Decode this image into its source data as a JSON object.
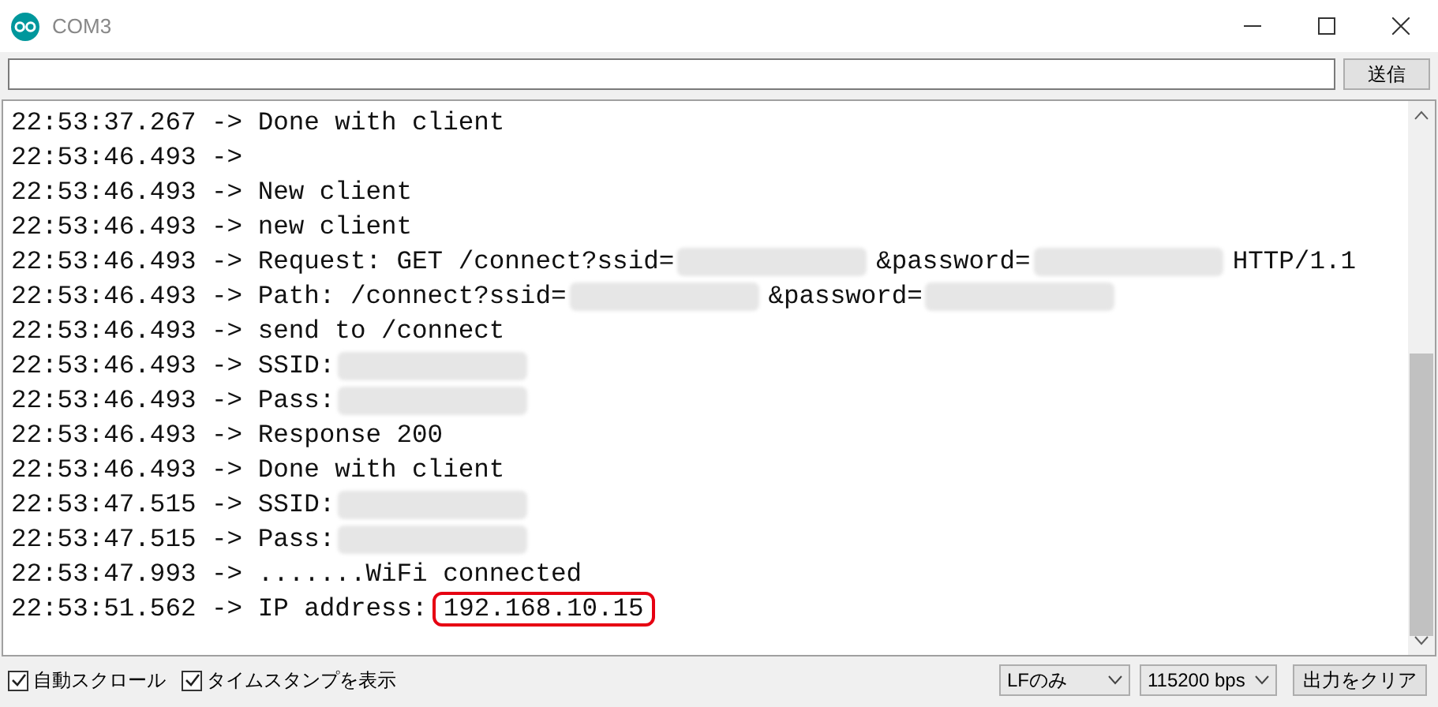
{
  "window": {
    "title": "COM3"
  },
  "send_button": {
    "label": "送信"
  },
  "log": [
    {
      "parts": [
        {
          "kind": "text",
          "text": "22:53:37.267 -> Done with client"
        }
      ]
    },
    {
      "parts": [
        {
          "kind": "text",
          "text": "22:53:46.493 ->"
        }
      ]
    },
    {
      "parts": [
        {
          "kind": "text",
          "text": "22:53:46.493 -> New client"
        }
      ]
    },
    {
      "parts": [
        {
          "kind": "text",
          "text": "22:53:46.493 -> new client"
        }
      ]
    },
    {
      "parts": [
        {
          "kind": "text",
          "text": "22:53:46.493 -> Request: GET /connect?ssid="
        },
        {
          "kind": "redacted"
        },
        {
          "kind": "text",
          "text": "&password="
        },
        {
          "kind": "redacted"
        },
        {
          "kind": "text",
          "text": "HTTP/1.1"
        }
      ]
    },
    {
      "parts": [
        {
          "kind": "text",
          "text": "22:53:46.493 -> Path: /connect?ssid="
        },
        {
          "kind": "redacted"
        },
        {
          "kind": "text",
          "text": "&password="
        },
        {
          "kind": "redacted"
        }
      ]
    },
    {
      "parts": [
        {
          "kind": "text",
          "text": "22:53:46.493 -> send to /connect"
        }
      ]
    },
    {
      "parts": [
        {
          "kind": "text",
          "text": "22:53:46.493 -> SSID:"
        },
        {
          "kind": "redacted"
        }
      ]
    },
    {
      "parts": [
        {
          "kind": "text",
          "text": "22:53:46.493 -> Pass:"
        },
        {
          "kind": "redacted"
        }
      ]
    },
    {
      "parts": [
        {
          "kind": "text",
          "text": "22:53:46.493 -> Response 200"
        }
      ]
    },
    {
      "parts": [
        {
          "kind": "text",
          "text": "22:53:46.493 -> Done with client"
        }
      ]
    },
    {
      "parts": [
        {
          "kind": "text",
          "text": "22:53:47.515 -> SSID:"
        },
        {
          "kind": "redacted"
        }
      ]
    },
    {
      "parts": [
        {
          "kind": "text",
          "text": "22:53:47.515 -> Pass:"
        },
        {
          "kind": "redacted"
        }
      ]
    },
    {
      "parts": [
        {
          "kind": "text",
          "text": "22:53:47.993 -> .......WiFi connected"
        }
      ]
    },
    {
      "parts": [
        {
          "kind": "text",
          "text": "22:53:51.562 -> IP address:"
        },
        {
          "kind": "text",
          "text": "192.168.10.15",
          "highlighted": true
        }
      ]
    }
  ],
  "options": [
    {
      "label": "自動スクロール",
      "checked": true
    },
    {
      "label": "タイムスタンプを表示",
      "checked": true
    }
  ],
  "line_ending": {
    "value": "LFのみ"
  },
  "baud_rate": {
    "value": "115200 bps"
  },
  "clear_button": {
    "label": "出力をクリア"
  }
}
